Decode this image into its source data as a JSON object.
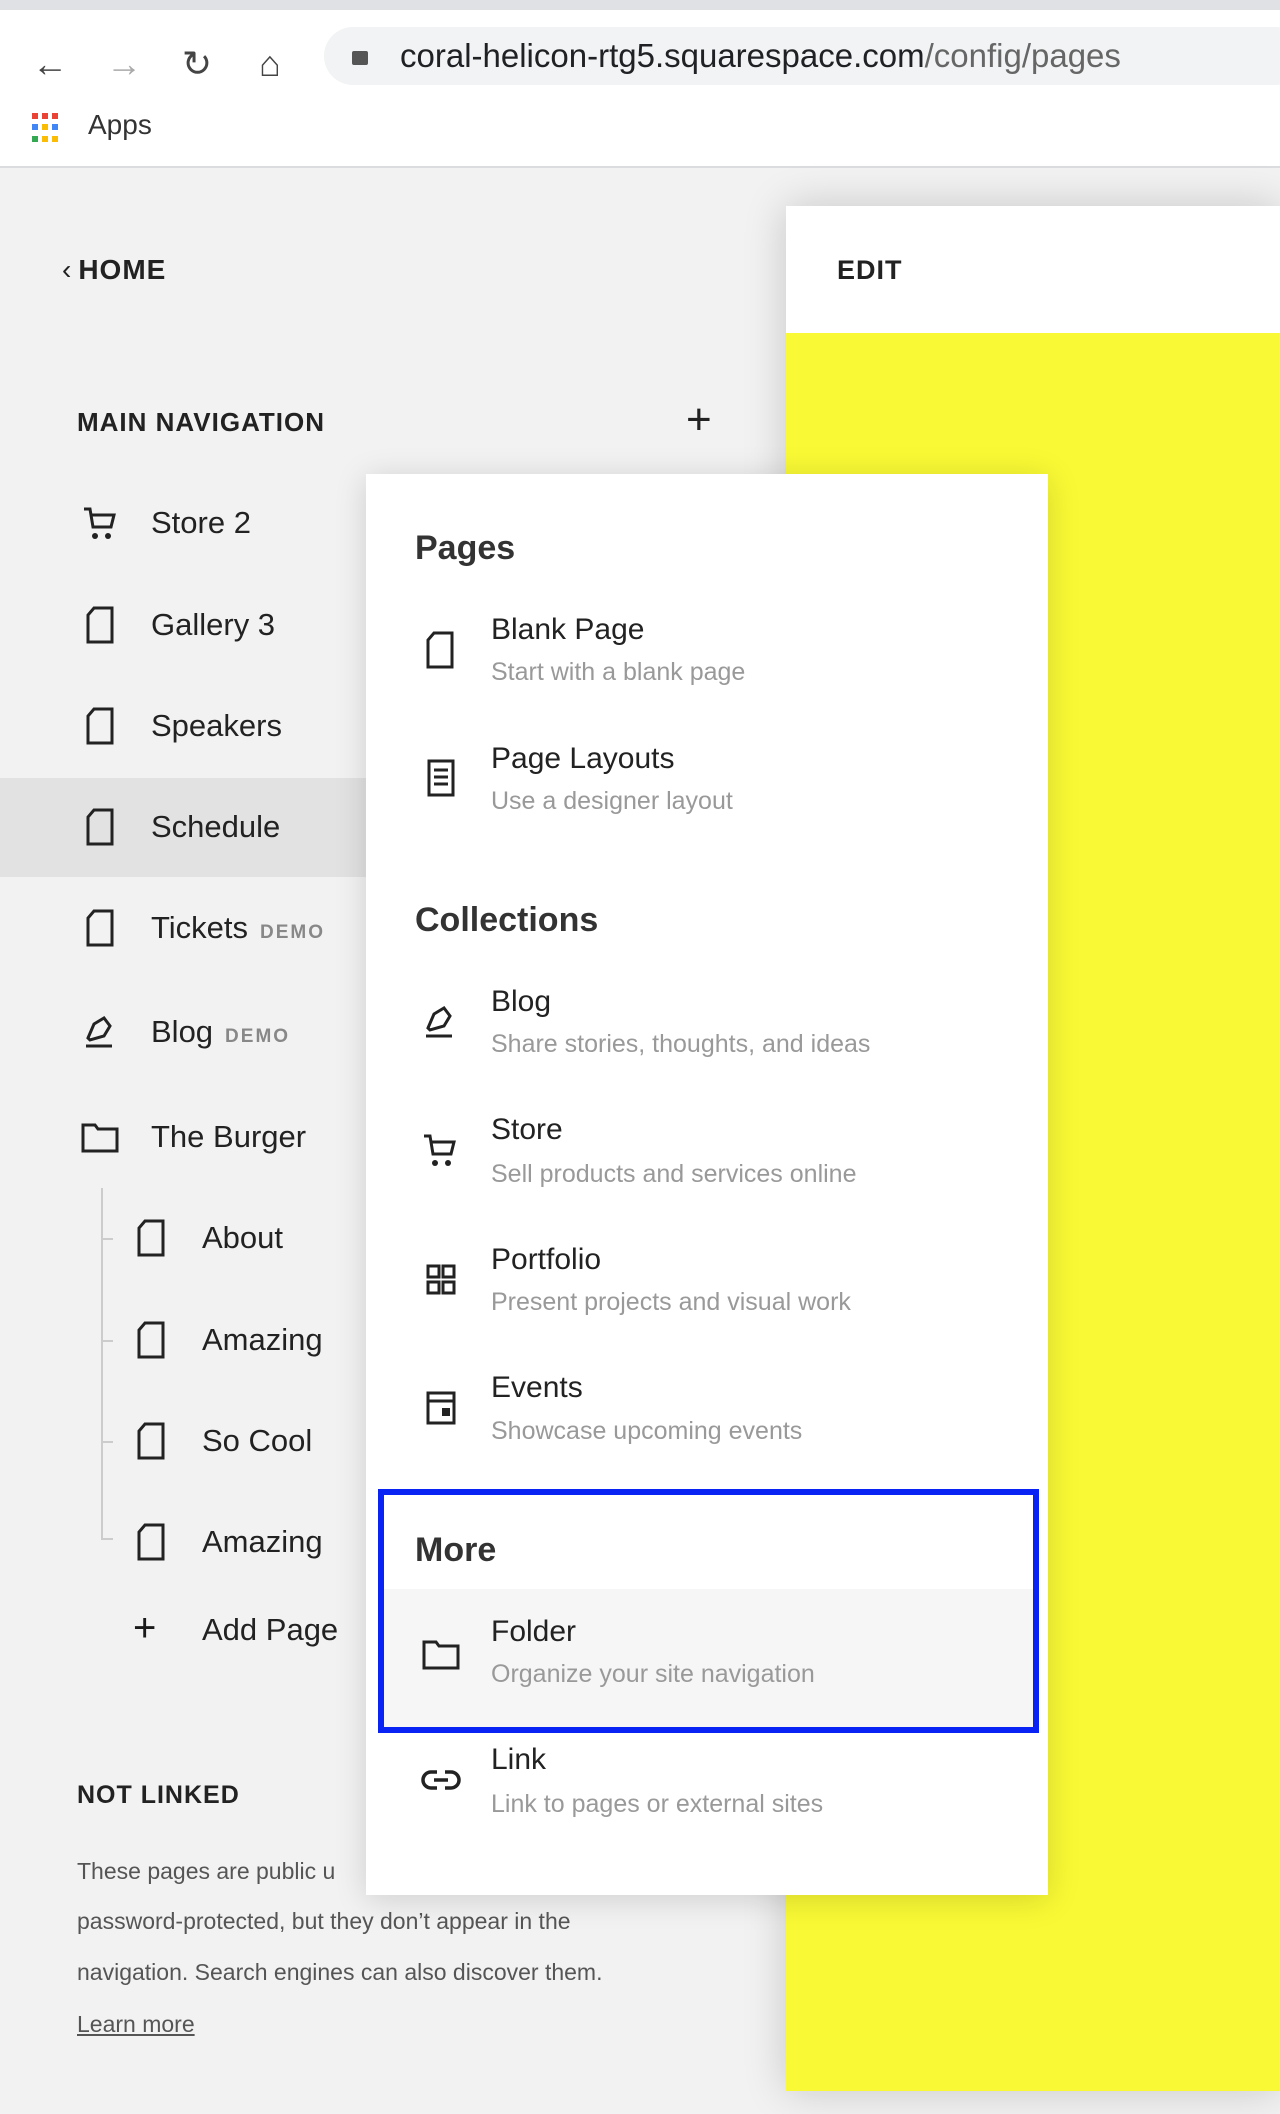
{
  "browser": {
    "url_host": "coral-helicon-rtg5.squarespace.com",
    "url_path": "/config/pages",
    "bookmark_apps": "Apps"
  },
  "sidebar": {
    "back_label": "HOME",
    "main_nav_heading": "MAIN NAVIGATION",
    "items": [
      {
        "label": "Store 2",
        "icon": "cart-icon"
      },
      {
        "label": "Gallery 3",
        "icon": "page-icon"
      },
      {
        "label": "Speakers",
        "icon": "page-icon"
      },
      {
        "label": "Schedule",
        "icon": "page-icon",
        "selected": true
      },
      {
        "label": "Tickets",
        "badge": "DEMO",
        "icon": "page-icon"
      },
      {
        "label": "Blog",
        "badge": "DEMO",
        "icon": "blog-icon"
      },
      {
        "label": "The Burger",
        "icon": "folder-icon"
      }
    ],
    "sub_items": [
      {
        "label": "About"
      },
      {
        "label": "Amazing"
      },
      {
        "label": "So Cool"
      },
      {
        "label": "Amazing"
      }
    ],
    "add_page": "Add Page",
    "not_linked_heading": "NOT LINKED",
    "not_linked_lines": [
      "These pages are public u",
      "password-protected, but they don’t appear in the",
      "navigation. Search engines can also discover them."
    ],
    "learn_more": "Learn more"
  },
  "edit_panel": {
    "label": "EDIT",
    "preview_color": "#f9f935"
  },
  "popup": {
    "sections": [
      {
        "heading": "Pages",
        "items": [
          {
            "title": "Blank Page",
            "desc": "Start with a blank page",
            "icon": "page-icon"
          },
          {
            "title": "Page Layouts",
            "desc": "Use a designer layout",
            "icon": "layout-icon"
          }
        ]
      },
      {
        "heading": "Collections",
        "items": [
          {
            "title": "Blog",
            "desc": "Share stories, thoughts, and ideas",
            "icon": "blog-icon"
          },
          {
            "title": "Store",
            "desc": "Sell products and services online",
            "icon": "cart-icon"
          },
          {
            "title": "Portfolio",
            "desc": "Present projects and visual work",
            "icon": "grid-icon"
          },
          {
            "title": "Events",
            "desc": "Showcase upcoming events",
            "icon": "calendar-icon"
          }
        ]
      },
      {
        "heading": "More",
        "items": [
          {
            "title": "Folder",
            "desc": "Organize your site navigation",
            "icon": "folder-icon"
          },
          {
            "title": "Link",
            "desc": "Link to pages or external sites",
            "icon": "link-icon"
          }
        ]
      }
    ],
    "highlight_color": "#0a23f5"
  }
}
